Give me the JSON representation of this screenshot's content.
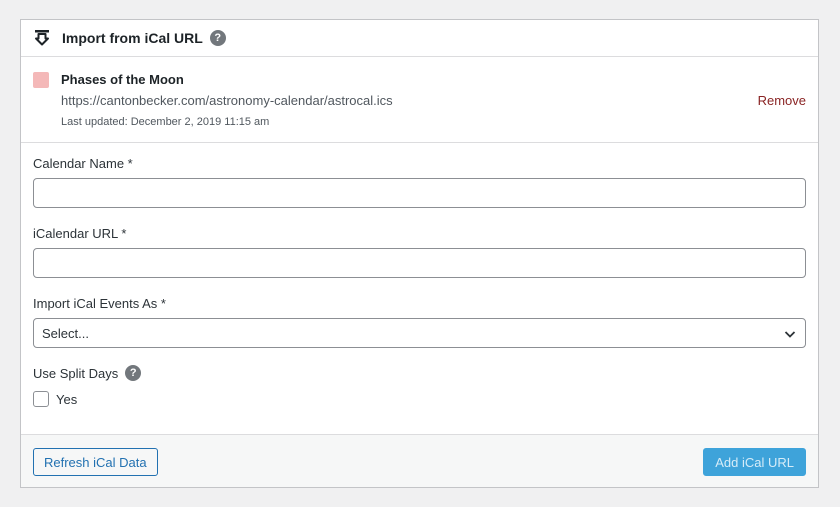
{
  "header": {
    "title": "Import from iCal URL",
    "icon": "import-download-icon",
    "help": "?"
  },
  "feed": {
    "name": "Phases of the Moon",
    "url": "https://cantonbecker.com/astronomy-calendar/astrocal.ics",
    "updated": "Last updated: December 2, 2019 11:15 am",
    "color": "#f4b8b8",
    "remove_label": "Remove"
  },
  "form": {
    "calendar_name_label": "Calendar Name *",
    "calendar_name_value": "",
    "ical_url_label": "iCalendar URL *",
    "ical_url_value": "",
    "import_as_label": "Import iCal Events As *",
    "import_as_selected": "Select...",
    "split_days_label": "Use Split Days",
    "split_days_help": "?",
    "split_days_option": "Yes"
  },
  "footer": {
    "refresh_label": "Refresh iCal Data",
    "add_label": "Add iCal URL"
  },
  "colors": {
    "accent": "#2271b1",
    "primary_button": "#3ea3da",
    "remove": "#8a2424"
  }
}
